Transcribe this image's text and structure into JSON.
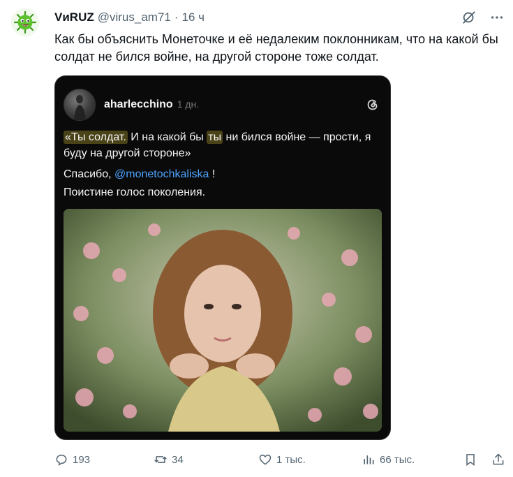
{
  "tweet": {
    "author_name": "VиRUZ",
    "author_handle": "@virus_am71",
    "separator": "·",
    "time": "16 ч",
    "text": "Как бы объяснить Монеточке и её недалеким поклонникам, что на какой бы солдат не бился войне, на другой стороне тоже солдат."
  },
  "quote": {
    "username": "aharlecchino",
    "time": "1 дн.",
    "line1_hl1": "«Ты солдат.",
    "line1_mid1": " И на какой бы ",
    "line1_hl2": "ты",
    "line1_rest": " ни бился войне — прости, я буду на другой стороне»",
    "line2_prefix": "Спасибо, ",
    "line2_mention": "@monetochkaliska",
    "line2_suffix": " !",
    "line3": "Поистине голос поколения."
  },
  "actions": {
    "replies": "193",
    "retweets": "34",
    "likes": "1 тыс.",
    "views": "66 тыс."
  },
  "icons": {
    "avatar": "green-virus-avatar-icon",
    "grok": "grok-icon",
    "more": "more-icon",
    "threads": "threads-icon",
    "reply": "reply-icon",
    "retweet": "retweet-icon",
    "like": "heart-icon",
    "views": "views-icon",
    "bookmark": "bookmark-icon",
    "share": "share-icon"
  },
  "colors": {
    "text": "#0f1419",
    "secondary": "#536471",
    "quote_bg": "#0a0a0a",
    "highlight": "#4a4318",
    "mention": "#4da3ff"
  }
}
